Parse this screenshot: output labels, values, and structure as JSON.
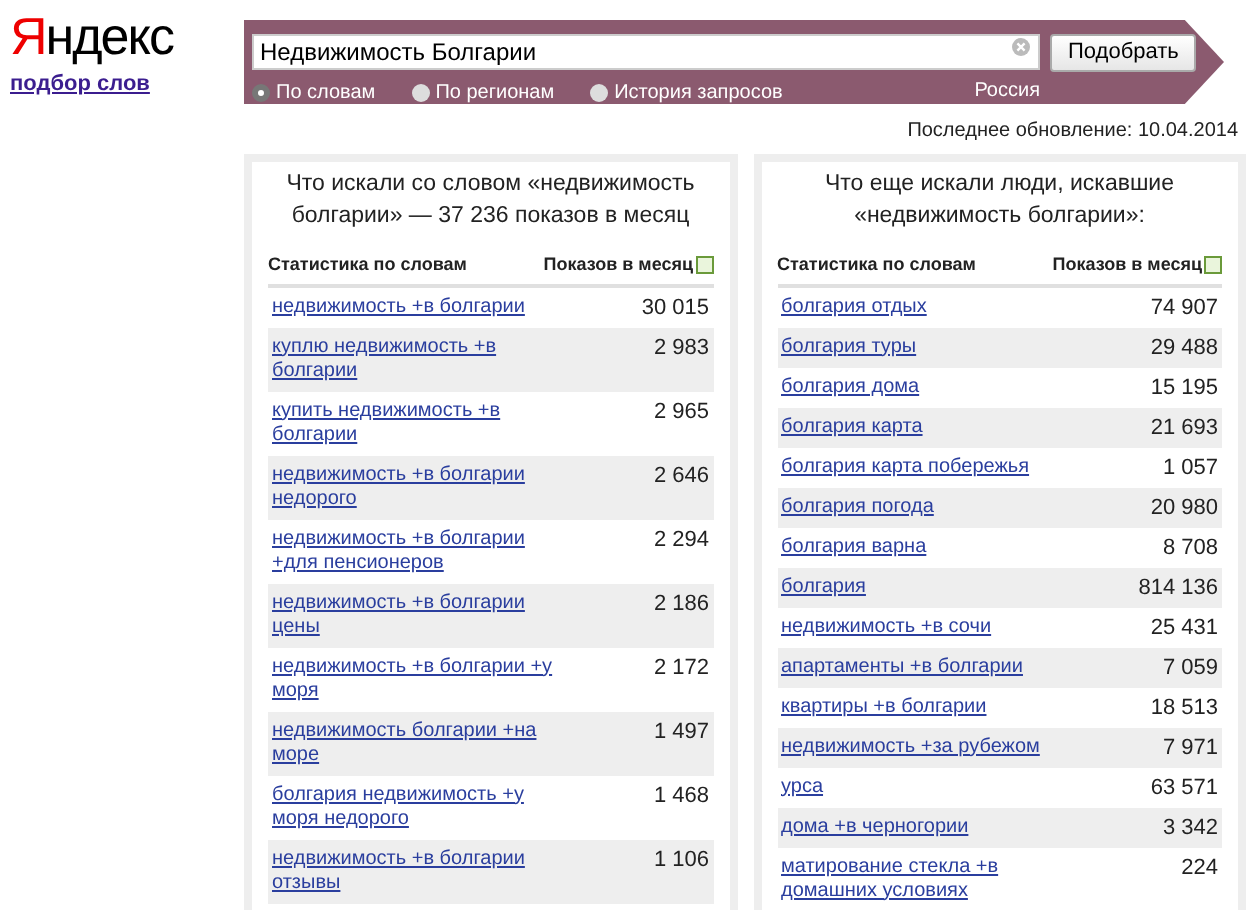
{
  "logo": {
    "text": "Яндекс",
    "subtitle": "подбор слов"
  },
  "search": {
    "value": "Недвижимость Болгарии",
    "button": "Подобрать",
    "region": "Россия",
    "modes": [
      {
        "label": "По словам",
        "selected": true
      },
      {
        "label": "По регионам",
        "selected": false
      },
      {
        "label": "История запросов",
        "selected": false
      }
    ]
  },
  "last_update": "Последнее обновление: 10.04.2014",
  "panels": [
    {
      "title": "Что искали со словом «недвижимость болгарии» — 37 236 показов в месяц",
      "columns": [
        "Статистика по словам",
        "Показов в месяц"
      ],
      "rows": [
        {
          "phrase": "недвижимость +в болгарии",
          "count": "30 015"
        },
        {
          "phrase": "куплю недвижимость +в болгарии",
          "count": "2 983"
        },
        {
          "phrase": "купить недвижимость +в болгарии",
          "count": "2 965"
        },
        {
          "phrase": "недвижимость +в болгарии недорого",
          "count": "2 646"
        },
        {
          "phrase": "недвижимость +в болгарии +для пенсионеров",
          "count": "2 294"
        },
        {
          "phrase": "недвижимость +в болгарии цены",
          "count": "2 186"
        },
        {
          "phrase": "недвижимость +в болгарии +у моря",
          "count": "2 172"
        },
        {
          "phrase": "недвижимость болгарии +на море",
          "count": "1 497"
        },
        {
          "phrase": "болгария недвижимость +у моря недорого",
          "count": "1 468"
        },
        {
          "phrase": "недвижимость +в болгарии отзывы",
          "count": "1 106"
        }
      ]
    },
    {
      "title": "Что еще искали люди, искавшие «недвижимость болгарии»:",
      "columns": [
        "Статистика по словам",
        "Показов в месяц"
      ],
      "rows": [
        {
          "phrase": "болгария отдых",
          "count": "74 907"
        },
        {
          "phrase": "болгария туры",
          "count": "29 488"
        },
        {
          "phrase": "болгария дома",
          "count": "15 195"
        },
        {
          "phrase": "болгария карта",
          "count": "21 693"
        },
        {
          "phrase": "болгария карта побережья",
          "count": "1 057"
        },
        {
          "phrase": "болгария погода",
          "count": "20 980"
        },
        {
          "phrase": "болгария варна",
          "count": "8 708"
        },
        {
          "phrase": "болгария",
          "count": "814 136"
        },
        {
          "phrase": "недвижимость +в сочи",
          "count": "25 431"
        },
        {
          "phrase": "апартаменты +в болгарии",
          "count": "7 059"
        },
        {
          "phrase": "квартиры +в болгарии",
          "count": "18 513"
        },
        {
          "phrase": "недвижимость +за рубежом",
          "count": "7 971"
        },
        {
          "phrase": "урса",
          "count": "63 571"
        },
        {
          "phrase": "дома +в черногории",
          "count": "3 342"
        },
        {
          "phrase": "матирование стекла +в домашних условиях",
          "count": "224"
        }
      ]
    }
  ]
}
